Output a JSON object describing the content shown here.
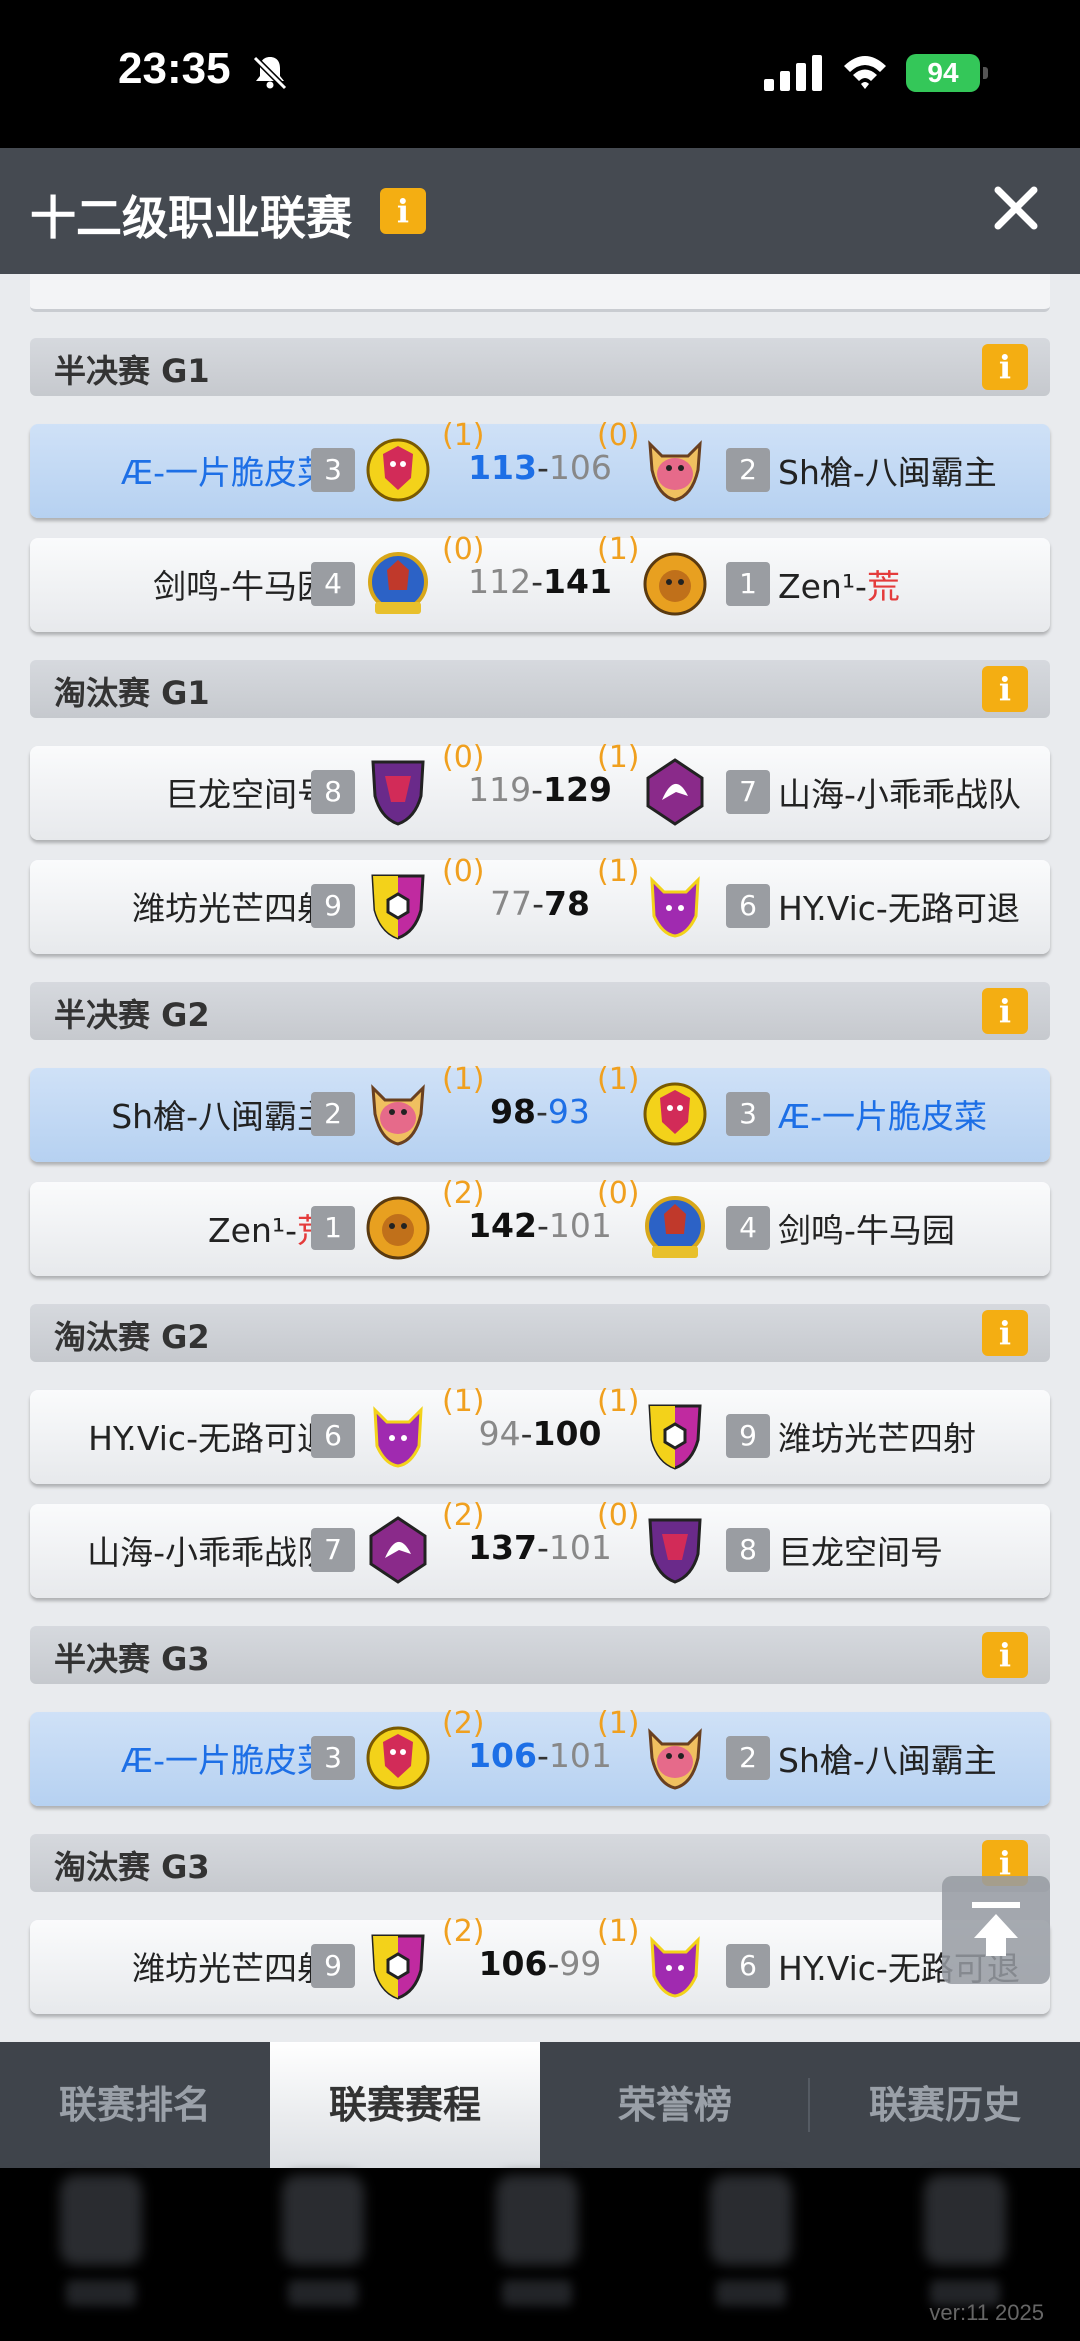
{
  "status": {
    "time": "23:35",
    "battery": "94"
  },
  "header": {
    "title": "十二级职业联赛",
    "info": "i"
  },
  "sections": [
    {
      "title": "半决赛 G1"
    },
    {
      "title": "淘汰赛 G1"
    },
    {
      "title": "半决赛 G2"
    },
    {
      "title": "淘汰赛 G2"
    },
    {
      "title": "半决赛 G3"
    },
    {
      "title": "淘汰赛 G3"
    }
  ],
  "matches": [
    {
      "left": "Æ-一片脆皮菜",
      "left_rank": "3",
      "left_wins": "(1)",
      "left_score": "113",
      "right_score": "106",
      "right_wins": "(0)",
      "right_rank": "2",
      "right": "Sh槍-八闽霸主"
    },
    {
      "left": "剑鸣-牛马园",
      "left_rank": "4",
      "left_wins": "(0)",
      "left_score": "112",
      "right_score": "141",
      "right_wins": "(1)",
      "right_rank": "1",
      "right_a": "Zen¹-",
      "right_b": "荒"
    },
    {
      "left": "巨龙空间号",
      "left_rank": "8",
      "left_wins": "(0)",
      "left_score": "119",
      "right_score": "129",
      "right_wins": "(1)",
      "right_rank": "7",
      "right": "山海-小乖乖战队"
    },
    {
      "left": "潍坊光芒四射",
      "left_rank": "9",
      "left_wins": "(0)",
      "left_score": "77",
      "right_score": "78",
      "right_wins": "(1)",
      "right_rank": "6",
      "right": "HY.Vic-无路可退"
    },
    {
      "left": "Sh槍-八闽霸主",
      "left_rank": "2",
      "left_wins": "(1)",
      "left_score": "98",
      "right_score": "93",
      "right_wins": "(1)",
      "right_rank": "3",
      "right": "Æ-一片脆皮菜"
    },
    {
      "left_a": "Zen¹-",
      "left_b": "荒",
      "left_rank": "1",
      "left_wins": "(2)",
      "left_score": "142",
      "right_score": "101",
      "right_wins": "(0)",
      "right_rank": "4",
      "right": "剑鸣-牛马园"
    },
    {
      "left": "HY.Vic-无路可退",
      "left_rank": "6",
      "left_wins": "(1)",
      "left_score": "94",
      "right_score": "100",
      "right_wins": "(1)",
      "right_rank": "9",
      "right": "潍坊光芒四射"
    },
    {
      "left": "山海-小乖乖战队",
      "left_rank": "7",
      "left_wins": "(2)",
      "left_score": "137",
      "right_score": "101",
      "right_wins": "(0)",
      "right_rank": "8",
      "right": "巨龙空间号"
    },
    {
      "left": "Æ-一片脆皮菜",
      "left_rank": "3",
      "left_wins": "(2)",
      "left_score": "106",
      "right_score": "101",
      "right_wins": "(1)",
      "right_rank": "2",
      "right": "Sh槍-八闽霸主"
    },
    {
      "left": "潍坊光芒四射",
      "left_rank": "9",
      "left_wins": "(2)",
      "left_score": "106",
      "right_score": "99",
      "right_wins": "(1)",
      "right_rank": "6",
      "right": "HY.Vic-无路可退"
    }
  ],
  "tabs": [
    "联赛排名",
    "联赛赛程",
    "荣誉榜",
    "联赛历史"
  ],
  "version": "ver:11  2025",
  "colors": {
    "highlight_blue": "#1d6fe6",
    "wins_orange": "#f0a01f",
    "accent_yellow": "#f4ae12",
    "header_bg": "#454a51"
  }
}
